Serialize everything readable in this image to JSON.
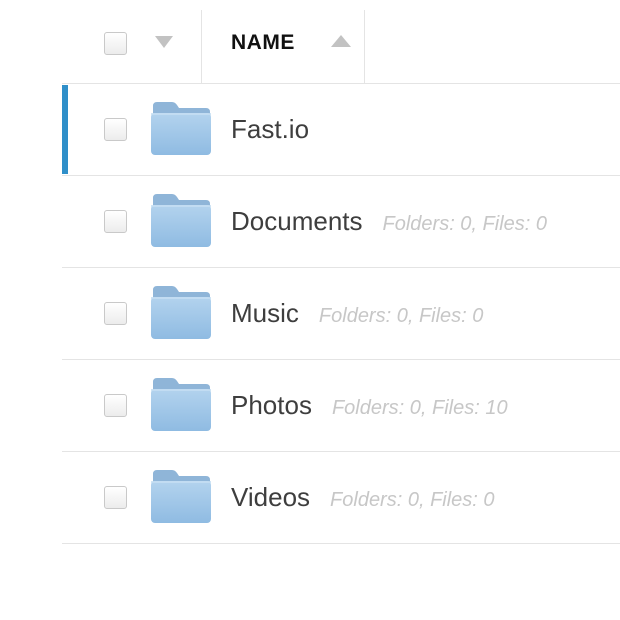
{
  "header": {
    "name_label": "NAME"
  },
  "rows": [
    {
      "name": "Fast.io",
      "meta": "",
      "active": true
    },
    {
      "name": "Documents",
      "meta": "Folders: 0, Files: 0",
      "active": false
    },
    {
      "name": "Music",
      "meta": "Folders: 0, Files: 0",
      "active": false
    },
    {
      "name": "Photos",
      "meta": "Folders: 0, Files: 10",
      "active": false
    },
    {
      "name": "Videos",
      "meta": "Folders: 0, Files: 0",
      "active": false
    }
  ],
  "colors": {
    "accent": "#2f8fc9",
    "folder_body": "#9cc3e6",
    "folder_tab": "#8fb5d8",
    "meta_text": "#c7c7c7",
    "name_text": "#3e3e3e"
  },
  "icons": {
    "folder": "folder-icon",
    "sort": "sort-ascending-icon",
    "dropdown": "chevron-down-icon"
  }
}
